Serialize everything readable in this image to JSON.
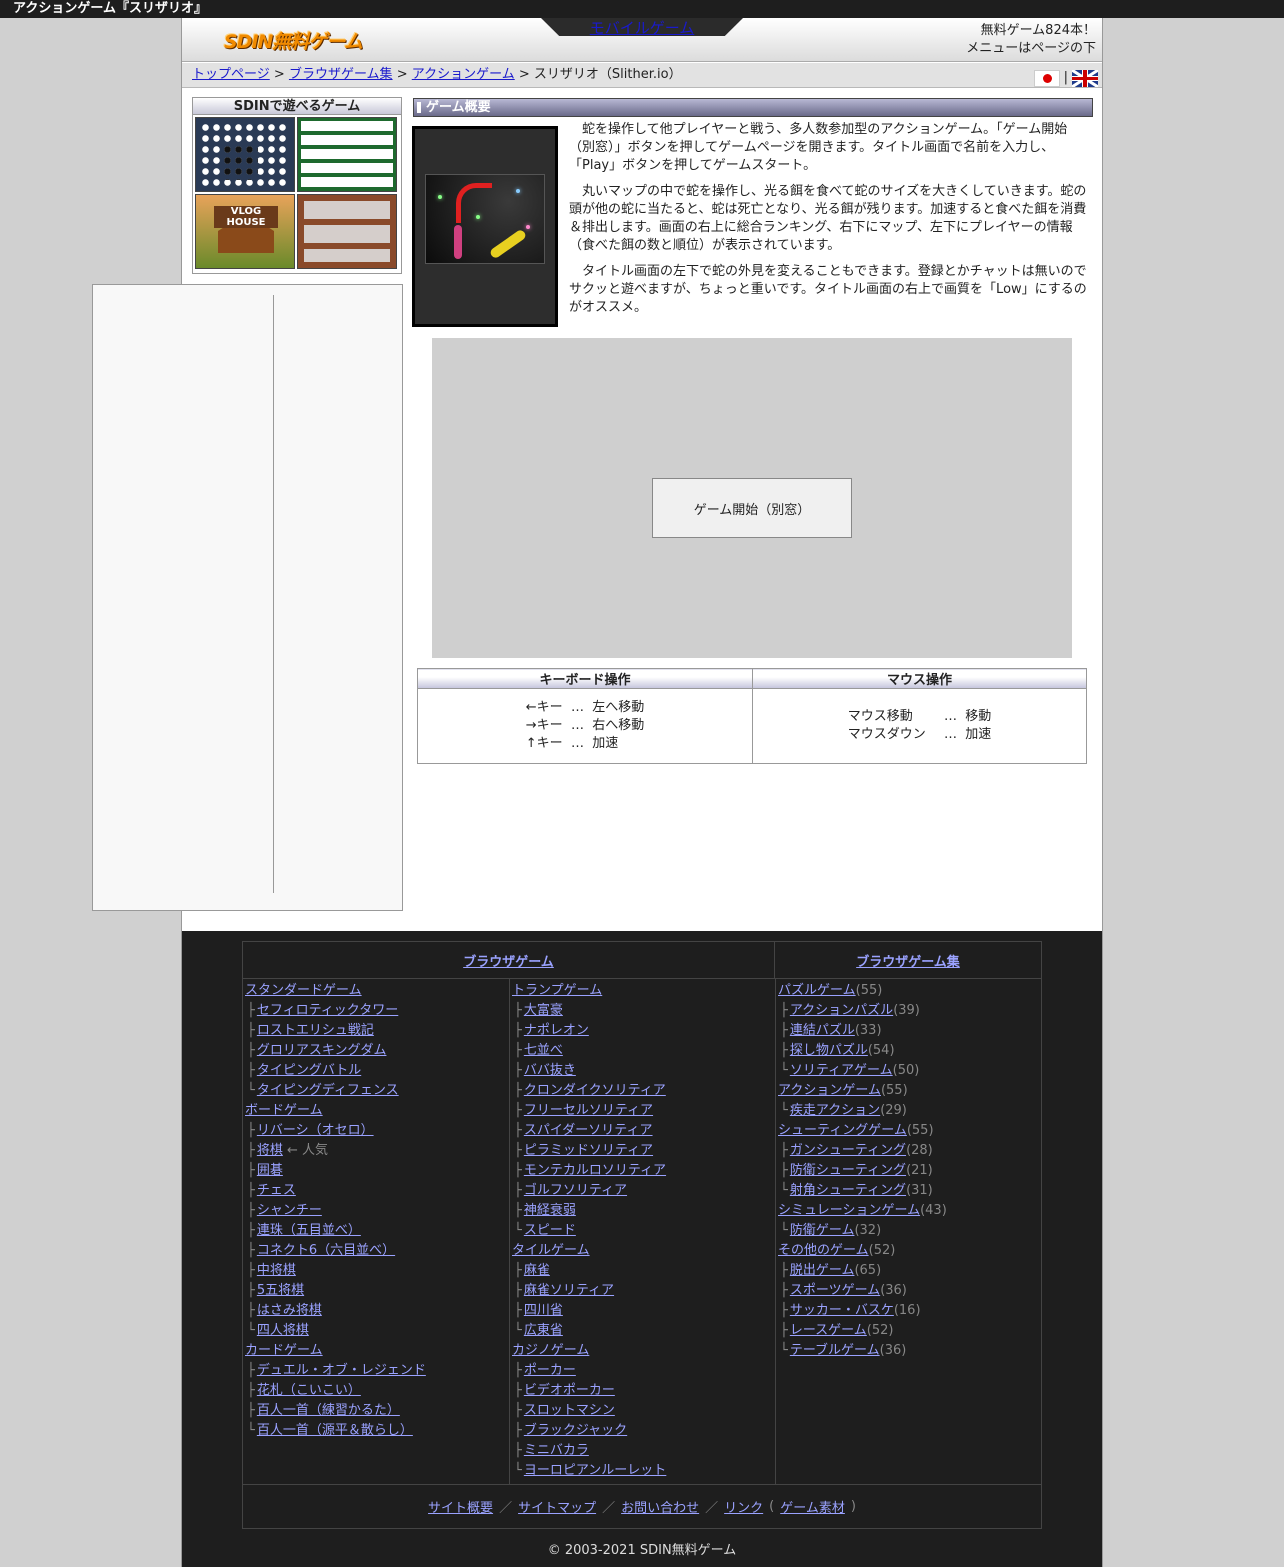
{
  "window": {
    "title": "アクションゲーム『スリザリオ』"
  },
  "header": {
    "logo_text": "SDIN無料ゲーム",
    "mobile_link": "モバイルゲーム",
    "count_text": "無料ゲーム824本！",
    "menu_note": "メニューはページの下"
  },
  "breadcrumb": {
    "items": [
      "トップページ",
      "ブラウザゲーム集",
      "アクションゲーム"
    ],
    "sep": ">",
    "current": "スリザリオ（Slither.io）",
    "flag_sep": "|"
  },
  "sidebar": {
    "title": "SDINで遊べるゲーム",
    "thumb3_sign": "VLOG HOUSE"
  },
  "main": {
    "section_title": "ゲーム概要",
    "desc": [
      "蛇を操作して他プレイヤーと戦う、多人数参加型のアクションゲーム。「ゲーム開始（別窓）」ボタンを押してゲームページを開きます。タイトル画面で名前を入力し、「Play」ボタンを押してゲームスタート。",
      "丸いマップの中で蛇を操作し、光る餌を食べて蛇のサイズを大きくしていきます。蛇の頭が他の蛇に当たると、蛇は死亡となり、光る餌が残ります。加速すると食べた餌を消費＆排出します。画面の右上に総合ランキング、右下にマップ、左下にプレイヤーの情報（食べた餌の数と順位）が表示されています。",
      "タイトル画面の左下で蛇の外見を変えることもできます。登録とかチャットは無いのでサクッと遊べますが、ちょっと重いです。タイトル画面の右上で画質を「Low」にするのがオススメ。"
    ],
    "start_button": "ゲーム開始（別窓）"
  },
  "controls": {
    "keyboard_header": "キーボード操作",
    "mouse_header": "マウス操作",
    "keyboard": [
      {
        "key": "←キー",
        "sep": "…",
        "action": "左へ移動"
      },
      {
        "key": "→キー",
        "sep": "…",
        "action": "右へ移動"
      },
      {
        "key": "↑キー",
        "sep": "…",
        "action": "加速"
      }
    ],
    "mouse": [
      {
        "key": "マウス移動",
        "sep": "…",
        "action": "移動"
      },
      {
        "key": "マウスダウン",
        "sep": "…",
        "action": "加速"
      }
    ]
  },
  "footer": {
    "head_left": "ブラウザゲーム",
    "head_right": "ブラウザゲーム集",
    "col1": [
      {
        "label": "スタンダードゲーム",
        "indent": ""
      },
      {
        "label": "セフィロティックタワー",
        "indent": "├"
      },
      {
        "label": "ロストエリシュ戦記",
        "indent": "├"
      },
      {
        "label": "グロリアスキングダム",
        "indent": "├"
      },
      {
        "label": "タイピングバトル",
        "indent": "├"
      },
      {
        "label": "タイピングディフェンス",
        "indent": "└"
      },
      {
        "label": "ボードゲーム",
        "indent": ""
      },
      {
        "label": "リバーシ（オセロ）",
        "indent": "├"
      },
      {
        "label": "将棋",
        "indent": "├",
        "note": " ← 人気"
      },
      {
        "label": "囲碁",
        "indent": "├"
      },
      {
        "label": "チェス",
        "indent": "├"
      },
      {
        "label": "シャンチー",
        "indent": "├"
      },
      {
        "label": "連珠（五目並べ）",
        "indent": "├"
      },
      {
        "label": "コネクト6（六目並べ）",
        "indent": "├"
      },
      {
        "label": "中将棋",
        "indent": "├"
      },
      {
        "label": "5五将棋",
        "indent": "├"
      },
      {
        "label": "はさみ将棋",
        "indent": "├"
      },
      {
        "label": "四人将棋",
        "indent": "└"
      },
      {
        "label": "カードゲーム",
        "indent": ""
      },
      {
        "label": "デュエル・オブ・レジェンド",
        "indent": "├"
      },
      {
        "label": "花札（こいこい）",
        "indent": "├"
      },
      {
        "label": "百人一首（練習かるた）",
        "indent": "├"
      },
      {
        "label": "百人一首（源平＆散らし）",
        "indent": "└"
      }
    ],
    "col2": [
      {
        "label": "トランプゲーム",
        "indent": ""
      },
      {
        "label": "大富豪",
        "indent": "├"
      },
      {
        "label": "ナポレオン",
        "indent": "├"
      },
      {
        "label": "七並べ",
        "indent": "├"
      },
      {
        "label": "ババ抜き",
        "indent": "├"
      },
      {
        "label": "クロンダイクソリティア",
        "indent": "├"
      },
      {
        "label": "フリーセルソリティア",
        "indent": "├"
      },
      {
        "label": "スパイダーソリティア",
        "indent": "├"
      },
      {
        "label": "ピラミッドソリティア",
        "indent": "├"
      },
      {
        "label": "モンテカルロソリティア",
        "indent": "├"
      },
      {
        "label": "ゴルフソリティア",
        "indent": "├"
      },
      {
        "label": "神経衰弱",
        "indent": "├"
      },
      {
        "label": "スピード",
        "indent": "└"
      },
      {
        "label": "タイルゲーム",
        "indent": ""
      },
      {
        "label": "麻雀",
        "indent": "├"
      },
      {
        "label": "麻雀ソリティア",
        "indent": "├"
      },
      {
        "label": "四川省",
        "indent": "├"
      },
      {
        "label": "広東省",
        "indent": "└"
      },
      {
        "label": "カジノゲーム",
        "indent": ""
      },
      {
        "label": "ポーカー",
        "indent": "├"
      },
      {
        "label": "ビデオポーカー",
        "indent": "├"
      },
      {
        "label": "スロットマシン",
        "indent": "├"
      },
      {
        "label": "ブラックジャック",
        "indent": "├"
      },
      {
        "label": "ミニバカラ",
        "indent": "├"
      },
      {
        "label": "ヨーロピアンルーレット",
        "indent": "└"
      }
    ],
    "col3": [
      {
        "label": "パズルゲーム",
        "indent": "",
        "count": "(55)"
      },
      {
        "label": "アクションパズル",
        "indent": "├",
        "count": "(39)"
      },
      {
        "label": "連結パズル",
        "indent": "├",
        "count": "(33)"
      },
      {
        "label": "探し物パズル",
        "indent": "├",
        "count": "(54)"
      },
      {
        "label": "ソリティアゲーム",
        "indent": "└",
        "count": "(50)"
      },
      {
        "label": "アクションゲーム",
        "indent": "",
        "count": "(55)"
      },
      {
        "label": "疾走アクション",
        "indent": "└",
        "count": "(29)"
      },
      {
        "label": "シューティングゲーム",
        "indent": "",
        "count": "(55)"
      },
      {
        "label": "ガンシューティング",
        "indent": "├",
        "count": "(28)"
      },
      {
        "label": "防衛シューティング",
        "indent": "├",
        "count": "(21)"
      },
      {
        "label": "射角シューティング",
        "indent": "└",
        "count": "(31)"
      },
      {
        "label": "シミュレーションゲーム",
        "indent": "",
        "count": "(43)"
      },
      {
        "label": "防衛ゲーム",
        "indent": "└",
        "count": "(32)"
      },
      {
        "label": "その他のゲーム",
        "indent": "",
        "count": "(52)"
      },
      {
        "label": "脱出ゲーム",
        "indent": "├",
        "count": "(65)"
      },
      {
        "label": "スポーツゲーム",
        "indent": "├",
        "count": "(36)"
      },
      {
        "label": "サッカー・バスケ",
        "indent": "├",
        "count": "(16)"
      },
      {
        "label": "レースゲーム",
        "indent": "├",
        "count": "(52)"
      },
      {
        "label": "テーブルゲーム",
        "indent": "└",
        "count": "(36)"
      }
    ],
    "links": {
      "about": "サイト概要",
      "sitemap": "サイトマップ",
      "contact": "お問い合わせ",
      "link": "リンク",
      "materials": "ゲーム素材",
      "sep": "／"
    },
    "copyright": "© 2003-2021 SDIN無料ゲーム"
  }
}
